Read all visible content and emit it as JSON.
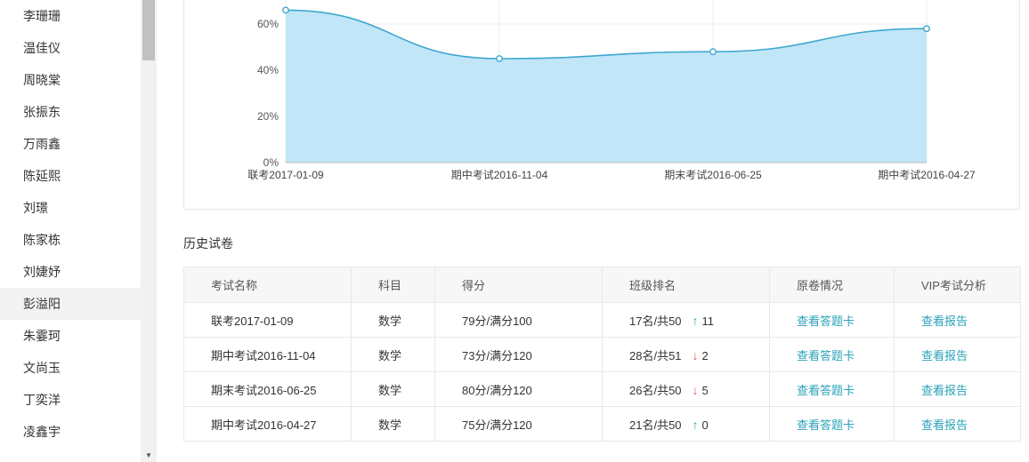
{
  "sidebar": {
    "students": [
      {
        "name": "李珊珊"
      },
      {
        "name": "温佳仪"
      },
      {
        "name": "周晓棠"
      },
      {
        "name": "张振东"
      },
      {
        "name": "万雨鑫"
      },
      {
        "name": "陈延熙"
      },
      {
        "name": "刘璟"
      },
      {
        "name": "陈家栋"
      },
      {
        "name": "刘婕妤"
      },
      {
        "name": "彭溢阳"
      },
      {
        "name": "朱霎珂"
      },
      {
        "name": "文尚玉"
      },
      {
        "name": "丁奕洋"
      },
      {
        "name": "凌鑫宇"
      }
    ],
    "active_index": 9
  },
  "chart_data": {
    "type": "area",
    "categories": [
      "联考2017-01-09",
      "期中考试2016-11-04",
      "期末考试2016-06-25",
      "期中考试2016-04-27"
    ],
    "values": [
      66,
      45,
      48,
      58
    ],
    "y_ticks": [
      "0%",
      "20%",
      "40%",
      "60%"
    ],
    "ylim": [
      0,
      70
    ],
    "grid": true,
    "colors": {
      "line": "#3fa7cf",
      "fill": "#bde5f8"
    }
  },
  "history": {
    "title": "历史试卷",
    "columns": [
      "考试名称",
      "科目",
      "得分",
      "班级排名",
      "原卷情况",
      "VIP考试分析"
    ],
    "rows": [
      {
        "name": "联考2017-01-09",
        "subject": "数学",
        "score": "79分/满分100",
        "rank": "17名/共50",
        "trend": "up",
        "trend_symbol": "↑",
        "change": "11",
        "paper": "查看答题卡",
        "report": "查看报告"
      },
      {
        "name": "期中考试2016-11-04",
        "subject": "数学",
        "score": "73分/满分120",
        "rank": "28名/共51",
        "trend": "down",
        "trend_symbol": "↓",
        "change": "2",
        "paper": "查看答题卡",
        "report": "查看报告"
      },
      {
        "name": "期末考试2016-06-25",
        "subject": "数学",
        "score": "80分/满分120",
        "rank": "26名/共50",
        "trend": "down",
        "trend_symbol": "↓",
        "change": "5",
        "paper": "查看答题卡",
        "report": "查看报告"
      },
      {
        "name": "期中考试2016-04-27",
        "subject": "数学",
        "score": "75分/满分120",
        "rank": "21名/共50",
        "trend": "up",
        "trend_symbol": "↑",
        "change": "0",
        "paper": "查看答题卡",
        "report": "查看报告"
      }
    ]
  }
}
